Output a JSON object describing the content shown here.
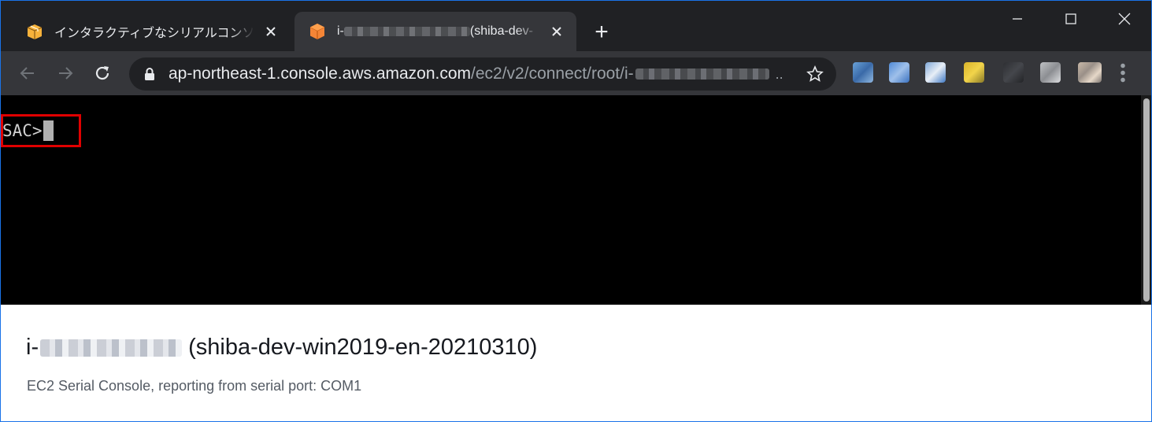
{
  "browser": {
    "tabs": [
      {
        "title": "インタラクティブなシリアルコンソール | E",
        "active": false,
        "favicon": "aws-box-icon"
      },
      {
        "title_prefix": "i-",
        "title_suffix": "(shiba-dev-",
        "active": true,
        "favicon": "ec2-cube-icon"
      }
    ],
    "new_tab_label": "+",
    "address": {
      "host": "ap-northeast-1.console.aws.amazon.com",
      "path": "/ec2/v2/connect/root/i-",
      "ellipsis": ".."
    }
  },
  "terminal": {
    "prompt": "SAC>"
  },
  "info": {
    "instance_prefix": "i-",
    "instance_name": "(shiba-dev-win2019-en-20210310)",
    "subtitle": "EC2 Serial Console, reporting from serial port: COM1"
  },
  "colors": {
    "highlight_box": "#e00000",
    "tab_active_bg": "#35363a",
    "terminal_bg": "#000000"
  }
}
